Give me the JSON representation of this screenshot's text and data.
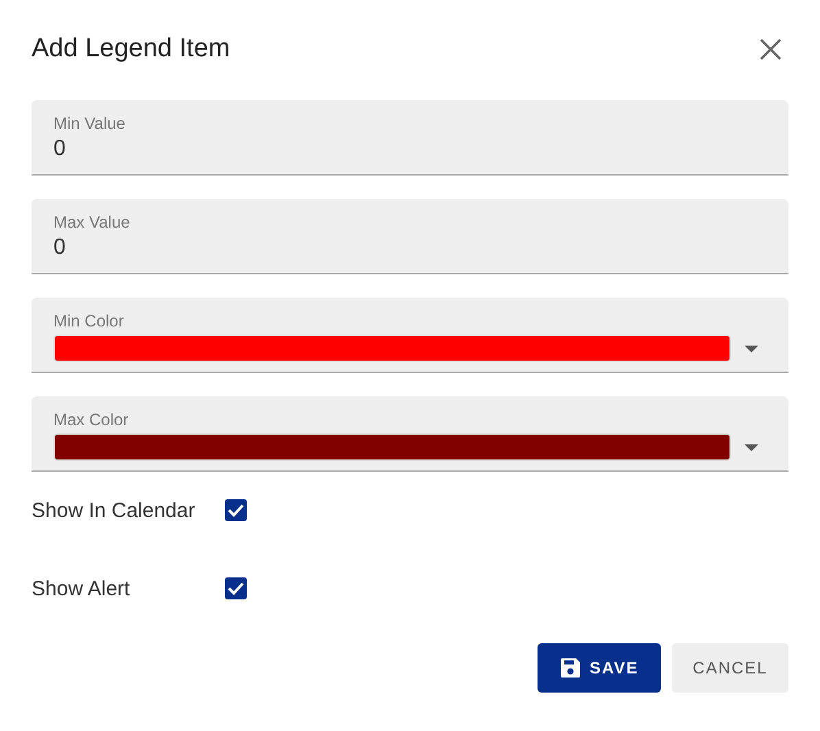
{
  "dialog": {
    "title": "Add Legend Item"
  },
  "fields": [
    {
      "kind": "text",
      "label": "Min Value",
      "value": "0"
    },
    {
      "kind": "text",
      "label": "Max Value",
      "value": "0"
    },
    {
      "kind": "color",
      "label": "Min Color",
      "color": "#ff0000"
    },
    {
      "kind": "color",
      "label": "Max Color",
      "color": "#800000"
    }
  ],
  "options": [
    {
      "label": "Show In Calendar",
      "checked": true
    },
    {
      "label": "Show Alert",
      "checked": true
    }
  ],
  "buttons": [
    {
      "kind": "primary",
      "label": "SAVE"
    },
    {
      "kind": "secondary",
      "label": "CANCEL"
    }
  ]
}
